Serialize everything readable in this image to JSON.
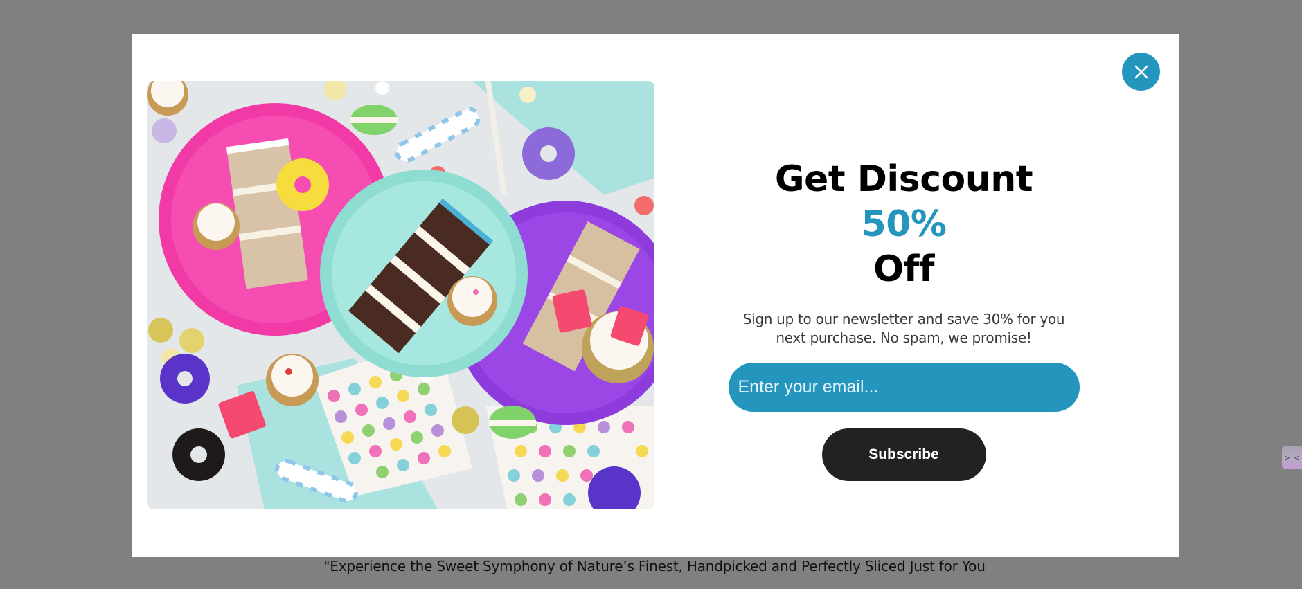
{
  "popup": {
    "headline_main": "Get Discount ",
    "headline_accent": "50%",
    "headline_tail": "Off",
    "description": "Sign up to our newsletter and save 30% for you next purchase. No spam, we promise!",
    "email": {
      "value": "",
      "placeholder": "Enter your email..."
    },
    "subscribe_label": "Subscribe",
    "close_icon": "close-icon",
    "accent_color": "#2495bd",
    "button_color": "#222222"
  },
  "hero_image": {
    "alt": "Colorful plates with cake slices, cupcakes, donuts and macarons"
  },
  "page": {
    "caption": "\"Experience the Sweet Symphony of Nature’s Finest, Handpicked and Perfectly Sliced Just for You",
    "overlay_color": "#808080"
  },
  "side_widget": {
    "icon": "chat-widget-icon",
    "glyph": ">_<"
  }
}
